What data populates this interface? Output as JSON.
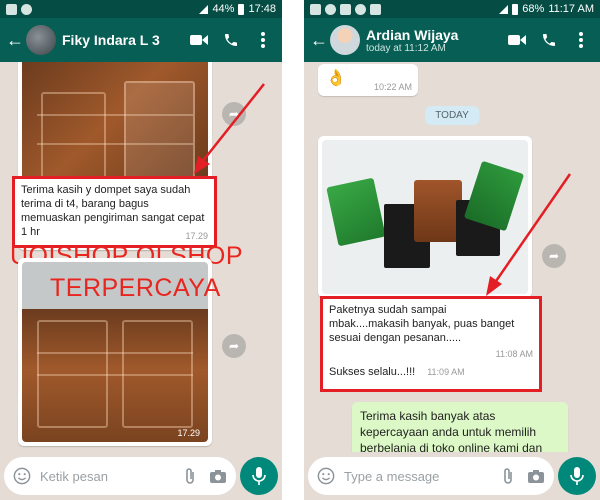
{
  "left": {
    "status": {
      "battery": "44%",
      "time": "17:48"
    },
    "header": {
      "name": "Fiky Indara L 3"
    },
    "photo1": {
      "time": ""
    },
    "caption": {
      "text": "Terima kasih y dompet saya sudah terima di t4, barang bagus memuaskan pengiriman sangat cepat 1 hr",
      "time": "17.29"
    },
    "watermark": {
      "line1": "UQISHOP OLSHOP",
      "line2": "TERPERCAYA"
    },
    "photo2": {
      "time": "17.29"
    },
    "input": {
      "placeholder": "Ketik pesan"
    }
  },
  "right": {
    "status": {
      "battery": "68%",
      "time": "11:17 AM"
    },
    "header": {
      "name": "Ardian Wijaya",
      "subtitle": "today at 11:12 AM"
    },
    "emoji_time": "10:22 AM",
    "date_pill": "TODAY",
    "caption": {
      "line1": "Paketnya sudah sampai mbak....makasih banyak, puas banget sesuai dengan pesanan.....",
      "time1": "11:08 AM",
      "line2": "Sukses selalu...!!!",
      "time2": "11:09 AM"
    },
    "outgoing": "Terima kasih banyak atas kepercayaan anda untuk memilih berbelanja di toko online kami dan",
    "input": {
      "placeholder": "Type a message"
    }
  },
  "icons": {
    "back": "arrow-back-icon",
    "video": "videocam-icon",
    "call": "phone-icon",
    "menu": "more-vert-icon",
    "emoji": "emoji-icon",
    "attach": "paperclip-icon",
    "camera": "camera-icon",
    "mic": "mic-icon",
    "share": "share-forward-icon"
  },
  "colors": {
    "header": "#075e54",
    "statusbar": "#054d44",
    "chat_bg": "#e5ddd5",
    "outgoing": "#dcf8c6",
    "annotation": "#e31e24",
    "mic": "#00897b"
  }
}
